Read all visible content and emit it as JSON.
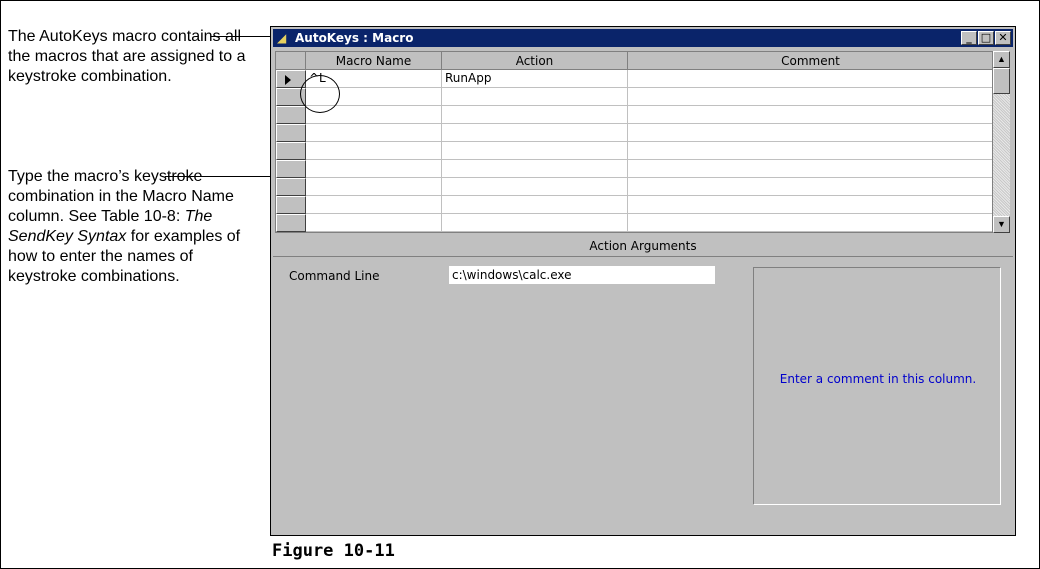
{
  "callouts": {
    "callout1": "The AutoKeys macro contains all the macros that are assigned to a keystroke combination.",
    "callout2_before": "Type the macro’s keystroke combination in the Macro Name column. See Table 10-8: ",
    "callout2_italic": "The SendKey Syntax",
    "callout2_after": " for examples of how to enter the names of keystroke combinations."
  },
  "window": {
    "title": "AutoKeys : Macro",
    "icon": "macro-icon",
    "controls": [
      "minimize",
      "maximize",
      "close"
    ]
  },
  "grid": {
    "columns": [
      "Macro Name",
      "Action",
      "Comment"
    ],
    "rows": [
      {
        "macro_name": "^L",
        "action": "RunApp",
        "comment": ""
      },
      {
        "macro_name": "",
        "action": "",
        "comment": ""
      },
      {
        "macro_name": "",
        "action": "",
        "comment": ""
      },
      {
        "macro_name": "",
        "action": "",
        "comment": ""
      },
      {
        "macro_name": "",
        "action": "",
        "comment": ""
      },
      {
        "macro_name": "",
        "action": "",
        "comment": ""
      },
      {
        "macro_name": "",
        "action": "",
        "comment": ""
      },
      {
        "macro_name": "",
        "action": "",
        "comment": ""
      }
    ]
  },
  "arguments": {
    "header": "Action Arguments",
    "command_line_label": "Command Line",
    "command_line_value": "c:\\windows\\calc.exe",
    "help_text": "Enter a comment in this column."
  },
  "figure_label": "Figure 10-11"
}
